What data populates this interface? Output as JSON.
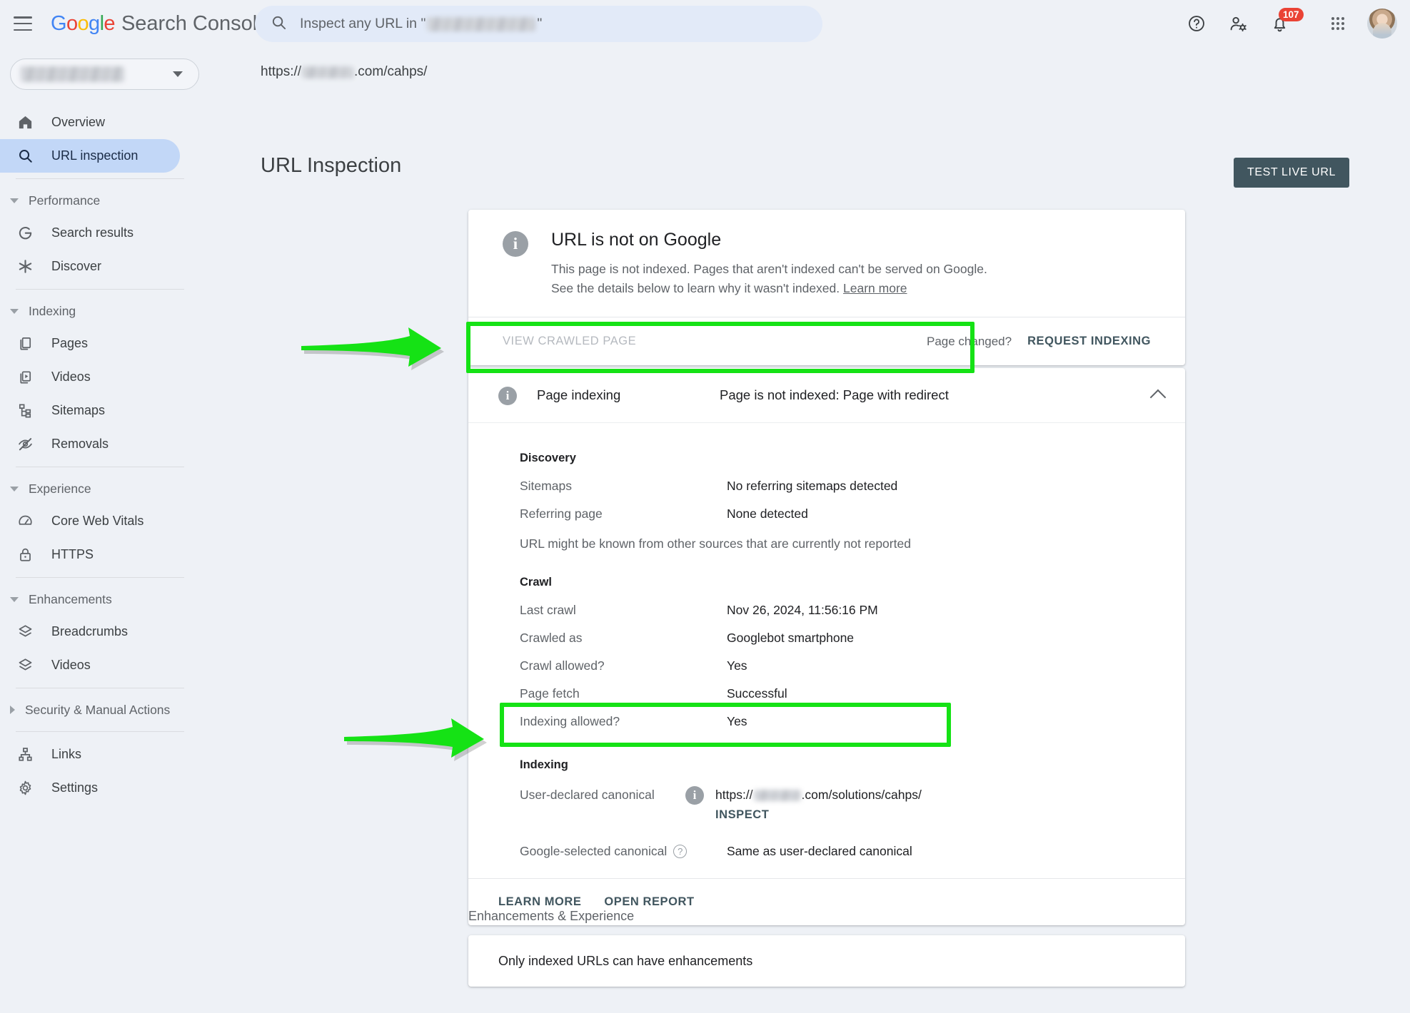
{
  "app": {
    "brand_google": "Google",
    "brand_product": "Search Console",
    "menu_icon": "hamburger-icon"
  },
  "search": {
    "placeholder_prefix": "Inspect any URL in \"",
    "placeholder_suffix": "\"",
    "icon": "search-icon"
  },
  "topright": {
    "help_icon": "help-icon",
    "user_settings_icon": "user-settings-icon",
    "notifications_icon": "bell-icon",
    "notifications_count": "107",
    "apps_icon": "apps-grid-icon",
    "avatar": "avatar"
  },
  "sidebar": {
    "property_selector_label": "",
    "items": [
      {
        "label": "Overview",
        "icon": "home-icon",
        "active": false
      },
      {
        "label": "URL inspection",
        "icon": "search-icon",
        "active": true
      }
    ],
    "groups": [
      {
        "label": "Performance",
        "expanded": true,
        "items": [
          {
            "label": "Search results",
            "icon": "google-g-icon"
          },
          {
            "label": "Discover",
            "icon": "asterisk-icon"
          }
        ]
      },
      {
        "label": "Indexing",
        "expanded": true,
        "items": [
          {
            "label": "Pages",
            "icon": "pages-icon"
          },
          {
            "label": "Videos",
            "icon": "video-icon"
          },
          {
            "label": "Sitemaps",
            "icon": "sitemap-icon"
          },
          {
            "label": "Removals",
            "icon": "eye-off-icon"
          }
        ]
      },
      {
        "label": "Experience",
        "expanded": true,
        "items": [
          {
            "label": "Core Web Vitals",
            "icon": "gauge-icon"
          },
          {
            "label": "HTTPS",
            "icon": "lock-icon"
          }
        ]
      },
      {
        "label": "Enhancements",
        "expanded": true,
        "items": [
          {
            "label": "Breadcrumbs",
            "icon": "layers-icon"
          },
          {
            "label": "Videos",
            "icon": "layers-icon"
          }
        ]
      },
      {
        "label": "Security & Manual Actions",
        "expanded": false,
        "items": []
      }
    ],
    "footer_items": [
      {
        "label": "Links",
        "icon": "links-icon"
      },
      {
        "label": "Settings",
        "icon": "gear-icon"
      }
    ]
  },
  "main": {
    "breadcrumb_prefix": "https://",
    "breadcrumb_suffix": ".com/cahps/",
    "page_title": "URL Inspection",
    "test_live_url_label": "TEST LIVE URL"
  },
  "status_card": {
    "icon": "info-icon",
    "title": "URL is not on Google",
    "description": "This page is not indexed. Pages that aren't indexed can't be served on Google. See the details below to learn why it wasn't indexed.",
    "learn_more_label": "Learn more",
    "view_crawled_page_label": "VIEW CRAWLED PAGE",
    "page_changed_label": "Page changed?",
    "request_indexing_label": "REQUEST INDEXING"
  },
  "indexing_card": {
    "icon": "info-icon",
    "header_label": "Page indexing",
    "header_value": "Page is not indexed: Page with redirect",
    "collapse_icon": "chevron-up-icon",
    "sections": [
      {
        "title": "Discovery",
        "rows": [
          {
            "label": "Sitemaps",
            "value": "No referring sitemaps detected"
          },
          {
            "label": "Referring page",
            "value": "None detected"
          }
        ],
        "note": "URL might be known from other sources that are currently not reported"
      },
      {
        "title": "Crawl",
        "rows": [
          {
            "label": "Last crawl",
            "value": "Nov 26, 2024, 11:56:16 PM"
          },
          {
            "label": "Crawled as",
            "value": "Googlebot smartphone"
          },
          {
            "label": "Crawl allowed?",
            "value": "Yes"
          },
          {
            "label": "Page fetch",
            "value": "Successful"
          },
          {
            "label": "Indexing allowed?",
            "value": "Yes"
          }
        ],
        "note": ""
      }
    ],
    "indexing_section_title": "Indexing",
    "user_declared_canonical": {
      "label": "User-declared canonical",
      "info_icon": "info-icon",
      "value_prefix": "https://",
      "value_suffix": ".com/solutions/cahps/",
      "inspect_label": "INSPECT"
    },
    "google_selected_canonical": {
      "label": "Google-selected canonical",
      "help_icon": "help-circle-icon",
      "value": "Same as user-declared canonical"
    },
    "footer_links": [
      "LEARN MORE",
      "OPEN REPORT"
    ]
  },
  "enhancements": {
    "section_label": "Enhancements & Experience",
    "message": "Only indexed URLs can have enhancements"
  },
  "annotations": {
    "highlight_color": "#15e215",
    "arrows": [
      "arrow-to-page-indexing",
      "arrow-to-user-declared-canonical"
    ],
    "highlights": [
      "highlight-page-indexing-row",
      "highlight-user-declared-canonical-row"
    ]
  }
}
